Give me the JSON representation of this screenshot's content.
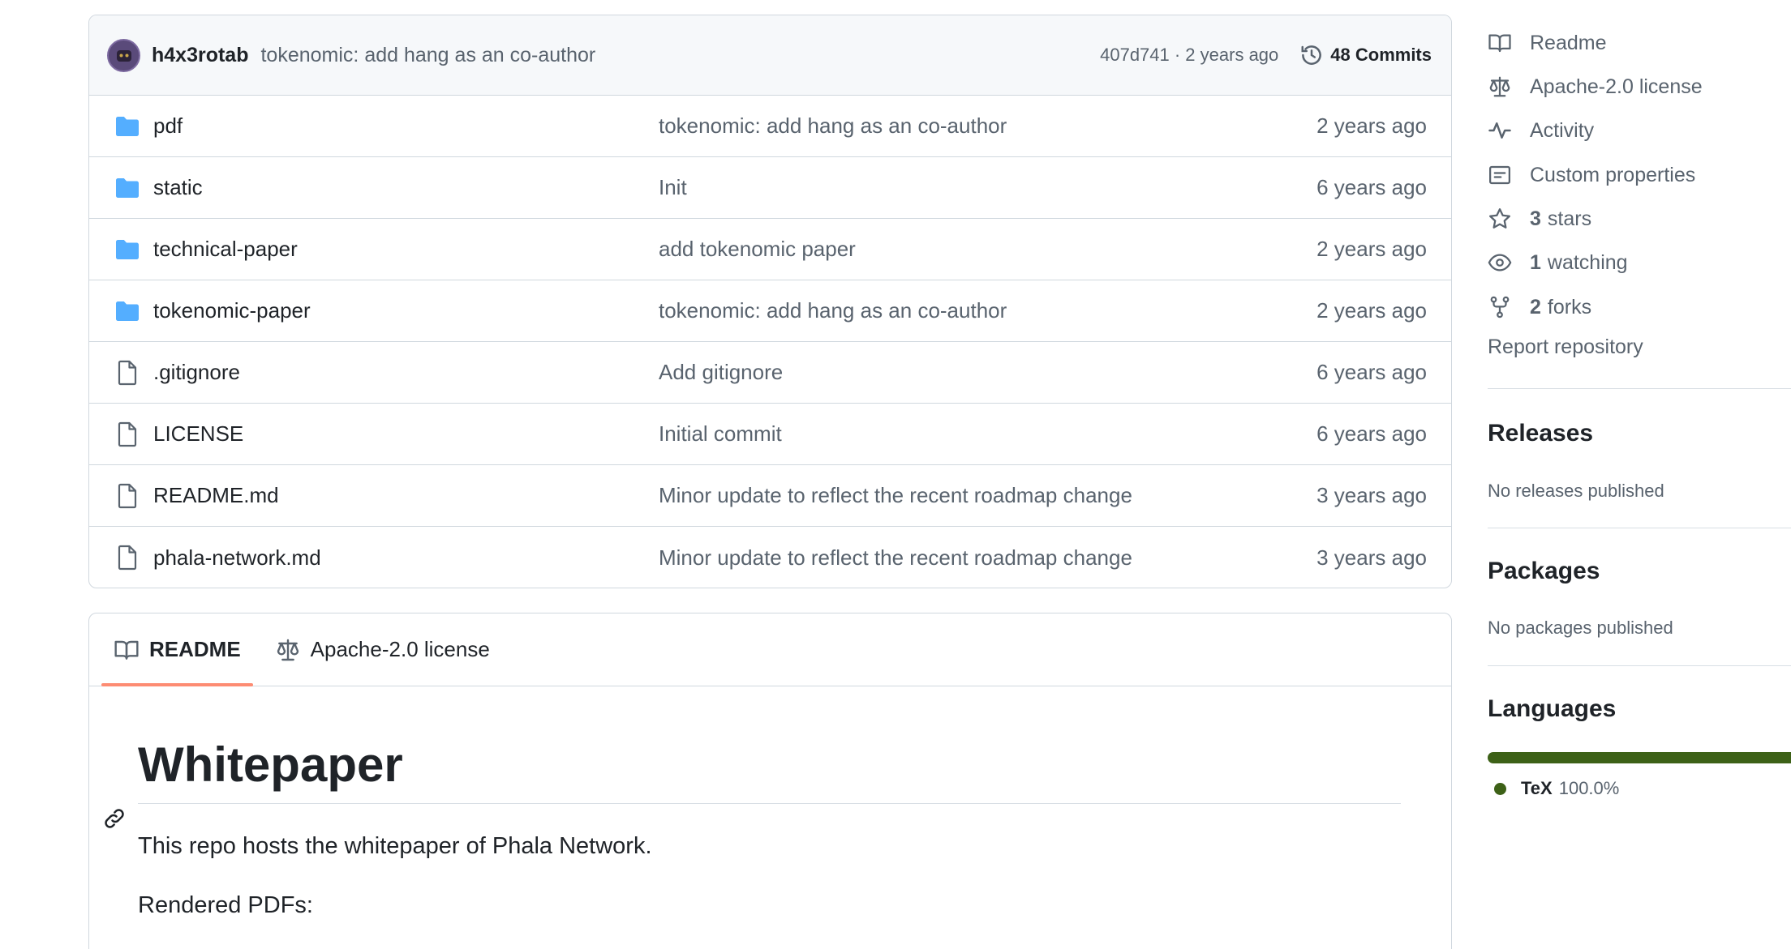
{
  "latest_commit": {
    "author": "h4x3rotab",
    "message": "tokenomic: add hang as an co-author",
    "meta": "407d741 · 2 years ago",
    "commits_label": "48 Commits"
  },
  "files": [
    {
      "name": "pdf",
      "type": "folder",
      "message": "tokenomic: add hang as an co-author",
      "age": "2 years ago"
    },
    {
      "name": "static",
      "type": "folder",
      "message": "Init",
      "age": "6 years ago"
    },
    {
      "name": "technical-paper",
      "type": "folder",
      "message": "add tokenomic paper",
      "age": "2 years ago"
    },
    {
      "name": "tokenomic-paper",
      "type": "folder",
      "message": "tokenomic: add hang as an co-author",
      "age": "2 years ago"
    },
    {
      "name": ".gitignore",
      "type": "file",
      "message": "Add gitignore",
      "age": "6 years ago"
    },
    {
      "name": "LICENSE",
      "type": "file",
      "message": "Initial commit",
      "age": "6 years ago"
    },
    {
      "name": "README.md",
      "type": "file",
      "message": "Minor update to reflect the recent roadmap change",
      "age": "3 years ago"
    },
    {
      "name": "phala-network.md",
      "type": "file",
      "message": "Minor update to reflect the recent roadmap change",
      "age": "3 years ago"
    }
  ],
  "readme_tabs": {
    "readme": "README",
    "license": "Apache-2.0 license"
  },
  "readme": {
    "heading": "Whitepaper",
    "intro": "This repo hosts the whitepaper of Phala Network.",
    "rendered": "Rendered PDFs:"
  },
  "sidebar": {
    "readme": "Readme",
    "license": "Apache-2.0 license",
    "activity": "Activity",
    "custom_properties": "Custom properties",
    "stars_count": "3",
    "stars_label": "stars",
    "watching_count": "1",
    "watching_label": "watching",
    "forks_count": "2",
    "forks_label": "forks",
    "report": "Report repository",
    "releases_title": "Releases",
    "releases_text": "No releases published",
    "packages_title": "Packages",
    "packages_text": "No packages published",
    "languages_title": "Languages",
    "language_name": "TeX",
    "language_pct": "100.0%"
  },
  "colors": {
    "folder": "#54aeff",
    "accent_tab": "#fd8c73",
    "tex": "#3d6117"
  }
}
